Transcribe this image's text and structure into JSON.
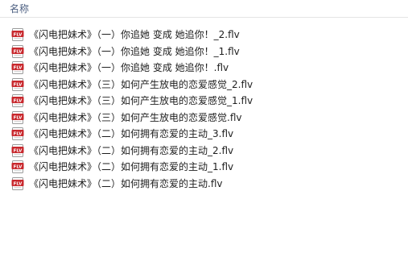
{
  "header": {
    "name_column": "名称"
  },
  "files": [
    {
      "name": "《闪电把妹术》（一）你追她 变成 她追你！_2.flv",
      "icon": "flv-file-icon"
    },
    {
      "name": "《闪电把妹术》（一）你追她 变成 她追你！_1.flv",
      "icon": "flv-file-icon"
    },
    {
      "name": "《闪电把妹术》（一）你追她 变成 她追你！.flv",
      "icon": "flv-file-icon"
    },
    {
      "name": "《闪电把妹术》（三）如何产生放电的恋爱感觉_2.flv",
      "icon": "flv-file-icon"
    },
    {
      "name": "《闪电把妹术》（三）如何产生放电的恋爱感觉_1.flv",
      "icon": "flv-file-icon"
    },
    {
      "name": "《闪电把妹术》（三）如何产生放电的恋爱感觉.flv",
      "icon": "flv-file-icon"
    },
    {
      "name": "《闪电把妹术》（二）如何拥有恋爱的主动_3.flv",
      "icon": "flv-file-icon"
    },
    {
      "name": "《闪电把妹术》（二）如何拥有恋爱的主动_2.flv",
      "icon": "flv-file-icon"
    },
    {
      "name": "《闪电把妹术》（二）如何拥有恋爱的主动_1.flv",
      "icon": "flv-file-icon"
    },
    {
      "name": "《闪电把妹术》（二）如何拥有恋爱的主动.flv",
      "icon": "flv-file-icon"
    }
  ],
  "icon_label": "FLV",
  "colors": {
    "header_text": "#4d6082",
    "file_text": "#1e1e1e",
    "icon_red": "#c8282d"
  }
}
